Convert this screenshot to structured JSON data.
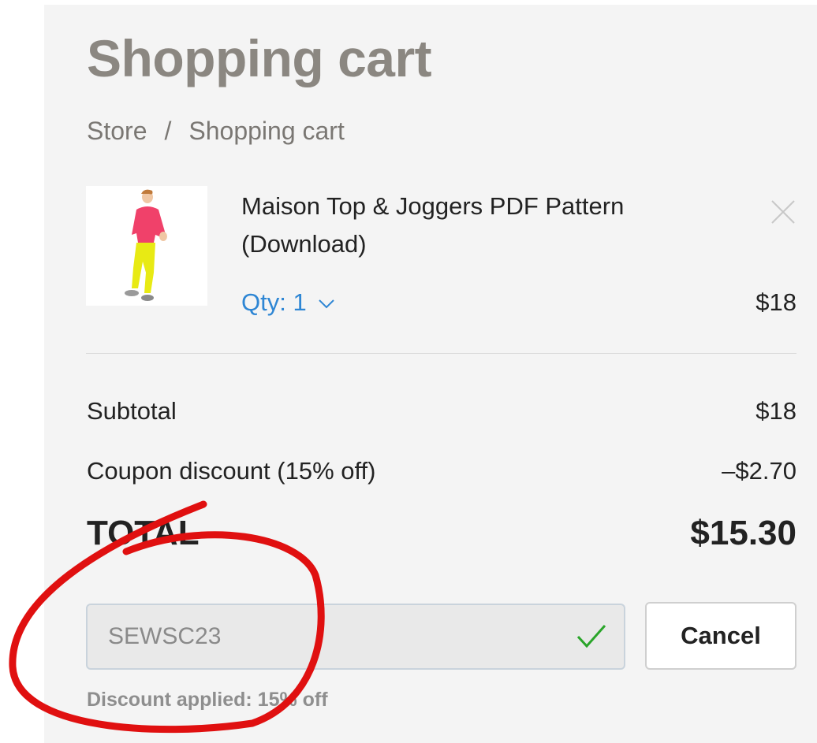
{
  "page": {
    "title": "Shopping cart"
  },
  "breadcrumb": {
    "items": [
      "Store",
      "Shopping cart"
    ],
    "separator": "/"
  },
  "cart": {
    "items": [
      {
        "name": "Maison Top & Joggers PDF Pattern (Download)",
        "qty_label": "Qty: 1",
        "price": "$18",
        "thumbnail_icon": "fashion-illustration-icon"
      }
    ]
  },
  "summary": {
    "subtotal_label": "Subtotal",
    "subtotal_value": "$18",
    "discount_label": "Coupon discount (15% off)",
    "discount_value": "–$2.70",
    "total_label": "TOTAL",
    "total_value": "$15.30"
  },
  "coupon": {
    "code": "SEWSC23",
    "cancel_label": "Cancel",
    "status": "Discount applied: 15% off"
  },
  "colors": {
    "accent_link": "#2e86d4",
    "success_check": "#2aa52a",
    "annotation": "#e01010",
    "title_gray": "#8b8781"
  }
}
